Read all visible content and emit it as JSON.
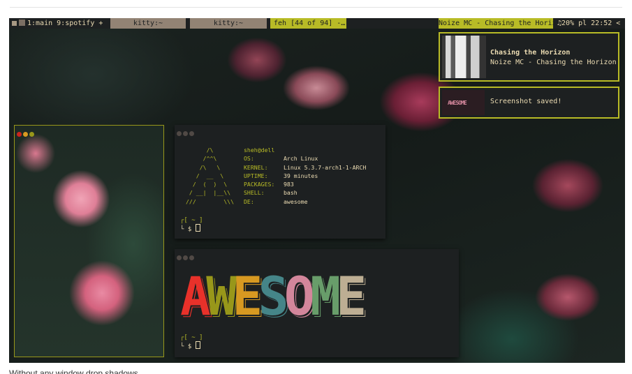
{
  "bar": {
    "main_tag": "1:main",
    "spotify_tag": "9:spotify +",
    "tasks": [
      "kitty:~",
      "kitty:~",
      "feh [44 of 94] -…"
    ],
    "now_playing": "Noize MC - Chasing the Horizon",
    "status": "♫20% pl 22:52 <",
    "accent": "#b8bb26"
  },
  "notifications": [
    {
      "title": "Chasing the Horizon",
      "body": "Noize MC - Chasing the Horizon"
    },
    {
      "title": "",
      "body": "Screenshot saved!",
      "thumb_text": "AWESOME"
    }
  ],
  "neofetch": {
    "ascii": "      /\\\n     /^^\\\n    /\\   \\\n   /  __  \\\n  /  (  )  \\\n / __|  |__\\\\\n///        \\\\\\",
    "user": "sheh@dell",
    "rows": [
      {
        "key": "OS:",
        "value": "Arch Linux"
      },
      {
        "key": "KERNEL:",
        "value": "Linux 5.3.7-arch1-1-ARCH"
      },
      {
        "key": "UPTIME:",
        "value": "39 minutes"
      },
      {
        "key": "PACKAGES:",
        "value": "983"
      },
      {
        "key": "SHELL:",
        "value": "bash"
      },
      {
        "key": "DE:",
        "value": "awesome"
      }
    ],
    "prompt_top": "┌[ ~ ]",
    "prompt_bottom": "└ $"
  },
  "banner": {
    "letters": [
      "A",
      "W",
      "E",
      "S",
      "O",
      "M",
      "E"
    ],
    "colors": [
      "#e8312a",
      "#98971a",
      "#d79921",
      "#458588",
      "#d3869b",
      "#689d6a",
      "#bdae93"
    ]
  },
  "caption": "Without any window drop shadows"
}
